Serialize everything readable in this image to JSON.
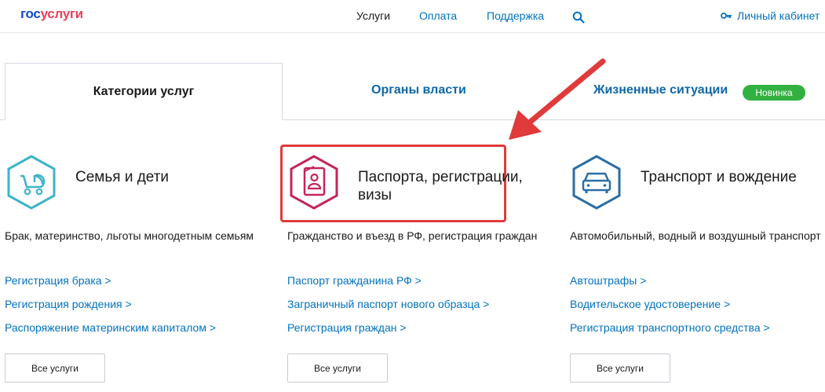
{
  "header": {
    "logo_part1": "гос",
    "logo_part2": "услуги",
    "nav": [
      "Услуги",
      "Оплата",
      "Поддержка"
    ],
    "search_icon": "search-icon",
    "cabinet_label": "Личный кабинет",
    "cabinet_icon": "key-icon"
  },
  "tabs": {
    "active": "Категории услуг",
    "organs": "Органы власти",
    "life": "Жизненные ситуации",
    "badge": "Новинка"
  },
  "categories": [
    {
      "title": "Семья и дети",
      "icon": "baby-stroller-icon",
      "description": "Брак, материнство, льготы многодетным семьям",
      "links": [
        "Регистрация брака >",
        "Регистрация рождения >",
        "Распоряжение материнским капиталом >"
      ],
      "button": "Все услуги"
    },
    {
      "title": "Паспорта, регистрации, визы",
      "icon": "passport-icon",
      "description": "Гражданство и въезд в РФ, регистрация граждан",
      "links": [
        "Паспорт гражданина РФ >",
        "Заграничный паспорт нового образца >",
        "Регистрация граждан >"
      ],
      "button": "Все услуги"
    },
    {
      "title": "Транспорт и вождение",
      "icon": "car-icon",
      "description": "Автомобильный, водный и воздушный транспорт",
      "links": [
        "Автоштрафы >",
        "Водительское удостоверение >",
        "Регистрация транспортного средства >"
      ],
      "button": "Все услуги"
    }
  ],
  "colors": {
    "brand_blue": "#0d4cd3",
    "brand_red": "#ee3f58",
    "link": "#0173c1",
    "badge_green": "#32b140",
    "highlight_red": "#e03a3a",
    "icon_teal": "#3db4c9",
    "icon_crimson": "#c2265a",
    "icon_blue": "#2a6ea5"
  }
}
